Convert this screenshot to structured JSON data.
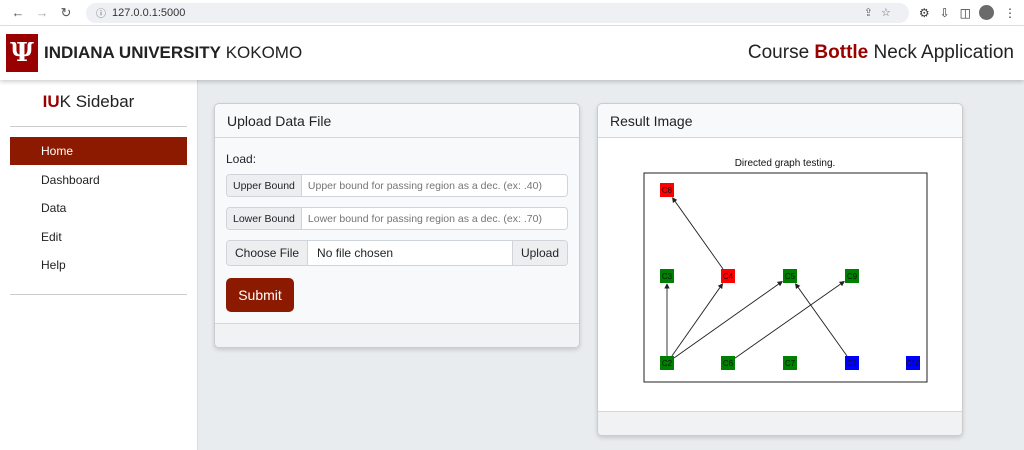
{
  "browser": {
    "url": "127.0.0.1:5000"
  },
  "header": {
    "brand_bold": "INDIANA UNIVERSITY",
    "brand_light": "KOKOMO",
    "title_pre": "Course ",
    "title_hl": "Bottle",
    "title_post": " Neck Application"
  },
  "sidebar": {
    "title_iu": "IU",
    "title_rest": "K Sidebar",
    "items": [
      {
        "label": "Home",
        "active": true
      },
      {
        "label": "Dashboard"
      },
      {
        "label": "Data"
      },
      {
        "label": "Edit"
      },
      {
        "label": "Help"
      }
    ]
  },
  "upload": {
    "title": "Upload Data File",
    "load_label": "Load:",
    "upper_label": "Upper Bound",
    "upper_placeholder": "Upper bound for passing region as a dec. (ex: .40)",
    "lower_label": "Lower Bound",
    "lower_placeholder": "Lower bound for passing region as a dec. (ex: .70)",
    "choose_label": "Choose File",
    "file_status": "No file chosen",
    "upload_label": "Upload",
    "submit_label": "Submit"
  },
  "result": {
    "title": "Result Image",
    "graph_title": "Directed graph testing.",
    "colors": {
      "red": "#ff0000",
      "green": "#008000",
      "blue": "#0000ff"
    },
    "nodes": [
      {
        "id": "C8",
        "color": "red"
      },
      {
        "id": "C3",
        "color": "green"
      },
      {
        "id": "C4",
        "color": "red"
      },
      {
        "id": "C5",
        "color": "green"
      },
      {
        "id": "C9",
        "color": "green"
      },
      {
        "id": "C2",
        "color": "green"
      },
      {
        "id": "C6",
        "color": "green"
      },
      {
        "id": "C7",
        "color": "green"
      },
      {
        "id": "C1",
        "color": "blue"
      },
      {
        "id": "C10",
        "color": "blue"
      }
    ],
    "edges": [
      [
        "C2",
        "C3"
      ],
      [
        "C2",
        "C4"
      ],
      [
        "C2",
        "C5"
      ],
      [
        "C4",
        "C8"
      ],
      [
        "C6",
        "C9"
      ],
      [
        "C1",
        "C5"
      ]
    ]
  }
}
